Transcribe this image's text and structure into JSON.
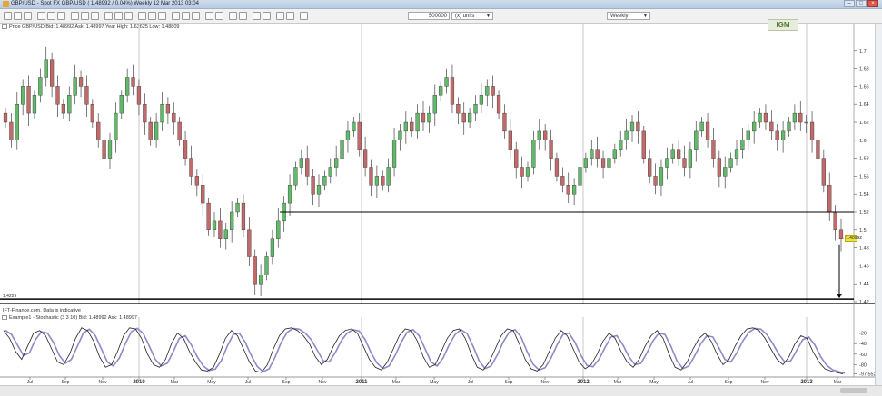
{
  "window": {
    "title": "GBP/USD - Spot FX GBP/USD (   1.48992 / 0.04%)   Weekly  12 Mar 2013 03:04"
  },
  "toolbar": {
    "bars_value": "500000",
    "units_value": "(x) units",
    "period_value": "Weekly",
    "logo_text": "IGM"
  },
  "price_panel": {
    "info": "Price  GBP/USD   Bid: 1.48992  Ask: 1.48997  Year High: 1.63625  Low: 1.48809",
    "current_price": "1.48992",
    "min_label": "1.4229",
    "y_ticks": [
      "1.7",
      "1.68",
      "1.66",
      "1.64",
      "1.62",
      "1.6",
      "1.58",
      "1.56",
      "1.54",
      "1.52",
      "1.5",
      "1.48",
      "1.46",
      "1.44",
      "1.42"
    ],
    "colors": {
      "up": "#62b96a",
      "down": "#c26a6a",
      "line": "#000000",
      "price_tag": "#f1e33f"
    }
  },
  "indicator_panel": {
    "disclaimer": "IFT-Finance.com. Data is indicative",
    "info": "Example1 - Stochastic (3 3 10)  Bid: 1.48992  Ask: 1.48997",
    "y_ticks": [
      "-20",
      "-40",
      "-60",
      "-80",
      "-97.552"
    ]
  },
  "x_axis": {
    "labels": [
      "Jul",
      "Sep",
      "Nov",
      "2010",
      "Mar",
      "May",
      "Jul",
      "Sep",
      "Nov",
      "2011",
      "Mar",
      "May",
      "Jul",
      "Sep",
      "Nov",
      "2012",
      "Mar",
      "May",
      "Jul",
      "Sep",
      "Nov",
      "2013",
      "Mar"
    ]
  },
  "chart_data": {
    "type": "candlestick",
    "title": "GBP/USD - Spot FX GBP/USD",
    "period": "Weekly",
    "ylim": [
      1.42,
      1.72
    ],
    "support_level": 1.52,
    "support_level_right": 1.52,
    "bottom_level": 1.4229,
    "current_price": 1.48992,
    "close": [
      1.62,
      1.6,
      1.64,
      1.66,
      1.63,
      1.65,
      1.67,
      1.69,
      1.66,
      1.64,
      1.63,
      1.65,
      1.67,
      1.66,
      1.64,
      1.62,
      1.6,
      1.58,
      1.6,
      1.63,
      1.65,
      1.67,
      1.66,
      1.64,
      1.62,
      1.6,
      1.62,
      1.64,
      1.63,
      1.62,
      1.6,
      1.58,
      1.56,
      1.55,
      1.53,
      1.5,
      1.51,
      1.49,
      1.5,
      1.52,
      1.53,
      1.5,
      1.47,
      1.44,
      1.45,
      1.47,
      1.49,
      1.51,
      1.53,
      1.55,
      1.57,
      1.58,
      1.56,
      1.54,
      1.55,
      1.56,
      1.57,
      1.58,
      1.6,
      1.61,
      1.62,
      1.59,
      1.57,
      1.55,
      1.56,
      1.55,
      1.57,
      1.6,
      1.61,
      1.62,
      1.61,
      1.63,
      1.62,
      1.63,
      1.65,
      1.66,
      1.67,
      1.64,
      1.63,
      1.62,
      1.63,
      1.64,
      1.65,
      1.66,
      1.65,
      1.63,
      1.61,
      1.59,
      1.57,
      1.56,
      1.57,
      1.6,
      1.61,
      1.6,
      1.58,
      1.56,
      1.55,
      1.54,
      1.55,
      1.57,
      1.58,
      1.59,
      1.58,
      1.57,
      1.58,
      1.59,
      1.6,
      1.61,
      1.62,
      1.61,
      1.58,
      1.56,
      1.55,
      1.57,
      1.58,
      1.59,
      1.58,
      1.57,
      1.59,
      1.61,
      1.62,
      1.6,
      1.58,
      1.56,
      1.57,
      1.58,
      1.59,
      1.6,
      1.61,
      1.62,
      1.63,
      1.62,
      1.61,
      1.6,
      1.61,
      1.62,
      1.63,
      1.62,
      1.62,
      1.6,
      1.58,
      1.55,
      1.52,
      1.5,
      1.49
    ],
    "stochastic_k": [
      -15,
      -30,
      -55,
      -70,
      -45,
      -20,
      -15,
      -25,
      -50,
      -75,
      -80,
      -60,
      -30,
      -10,
      -15,
      -35,
      -65,
      -85,
      -80,
      -55,
      -25,
      -10,
      -12,
      -30,
      -60,
      -80,
      -85,
      -70,
      -40,
      -20,
      -30,
      -55,
      -75,
      -90,
      -92,
      -85,
      -60,
      -30,
      -15,
      -25,
      -50,
      -75,
      -92,
      -95,
      -80,
      -50,
      -25,
      -12,
      -10,
      -15,
      -25,
      -40,
      -65,
      -80,
      -70,
      -45,
      -25,
      -15,
      -12,
      -20,
      -45,
      -70,
      -85,
      -90,
      -75,
      -50,
      -25,
      -12,
      -15,
      -35,
      -65,
      -85,
      -80,
      -55,
      -30,
      -15,
      -12,
      -30,
      -60,
      -85,
      -90,
      -75,
      -50,
      -25,
      -12,
      -15,
      -40,
      -70,
      -88,
      -92,
      -80,
      -55,
      -30,
      -15,
      -25,
      -50,
      -75,
      -88,
      -80,
      -60,
      -35,
      -20,
      -30,
      -55,
      -75,
      -85,
      -70,
      -45,
      -25,
      -15,
      -30,
      -60,
      -85,
      -90,
      -75,
      -50,
      -30,
      -20,
      -35,
      -60,
      -80,
      -70,
      -45,
      -25,
      -12,
      -10,
      -15,
      -30,
      -50,
      -70,
      -80,
      -65,
      -40,
      -25,
      -30,
      -55,
      -75,
      -88,
      -92,
      -95,
      -97.552
    ]
  }
}
